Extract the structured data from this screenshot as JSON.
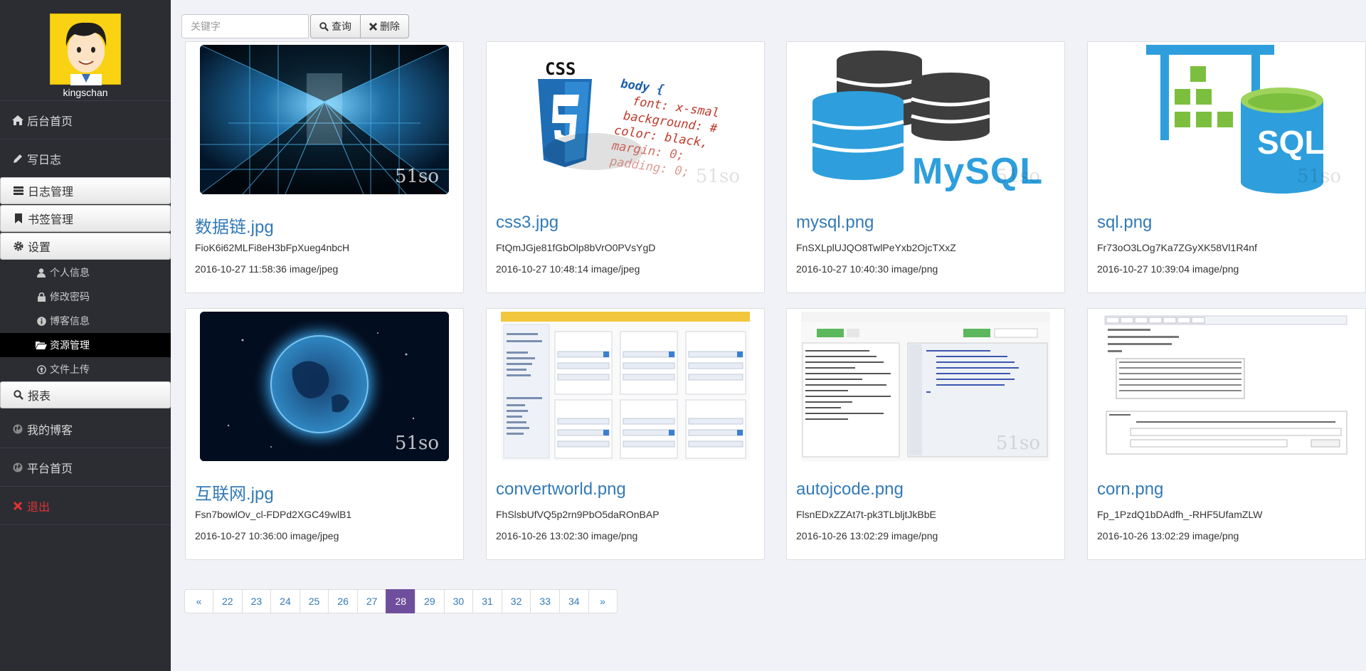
{
  "sidebar": {
    "username": "kingschan",
    "items": [
      {
        "label": "后台首页",
        "icon": "home-icon"
      },
      {
        "label": "写日志",
        "icon": "pencil-icon"
      },
      {
        "label": "日志管理",
        "icon": "list-icon"
      },
      {
        "label": "书签管理",
        "icon": "bookmark-icon"
      },
      {
        "label": "设置",
        "icon": "gear-icon"
      },
      {
        "label": "报表",
        "icon": "search-icon"
      },
      {
        "label": "我的博客",
        "icon": "globe-icon"
      },
      {
        "label": "平台首页",
        "icon": "globe-icon"
      },
      {
        "label": "退出",
        "icon": "close-icon"
      }
    ],
    "sub_items": [
      {
        "label": "个人信息",
        "icon": "user-icon"
      },
      {
        "label": "修改密码",
        "icon": "lock-icon"
      },
      {
        "label": "博客信息",
        "icon": "info-icon"
      },
      {
        "label": "资源管理",
        "icon": "folder-open-icon"
      },
      {
        "label": "文件上传",
        "icon": "upload-icon"
      }
    ]
  },
  "toolbar": {
    "search_placeholder": "关键字",
    "query_label": "查询",
    "delete_label": "删除"
  },
  "cards": [
    {
      "title": "数据链.jpg",
      "key": "FioK6i62MLFi8eH3bFpXueg4nbcH",
      "meta": "2016-10-27 11:58:36 image/jpeg"
    },
    {
      "title": "css3.jpg",
      "key": "FtQmJGje81fGbOlp8bVrO0PVsYgD",
      "meta": "2016-10-27 10:48:14 image/jpeg"
    },
    {
      "title": "mysql.png",
      "key": "FnSXLplUJQO8TwlPeYxb2OjcTXxZ",
      "meta": "2016-10-27 10:40:30 image/png"
    },
    {
      "title": "sql.png",
      "key": "Fr73oO3LOg7Ka7ZGyXK58Vl1R4nf",
      "meta": "2016-10-27 10:39:04 image/png"
    },
    {
      "title": "互联网.jpg",
      "key": "Fsn7bowlOv_cl-FDPd2XGC49wlB1",
      "meta": "2016-10-27 10:36:00 image/jpeg"
    },
    {
      "title": "convertworld.png",
      "key": "FhSlsbUfVQ5p2rn9PbO5daROnBAP",
      "meta": "2016-10-26 13:02:30 image/png"
    },
    {
      "title": "autojcode.png",
      "key": "FlsnEDxZZAt7t-pk3TLbljtJkBbE",
      "meta": "2016-10-26 13:02:29 image/png"
    },
    {
      "title": "corn.png",
      "key": "Fp_1PzdQ1bDAdfh_-RHF5UfamZLW",
      "meta": "2016-10-26 13:02:29 image/png"
    }
  ],
  "thumb_text": {
    "watermark": "51so",
    "css_badge": "CSS",
    "css_num": "3",
    "css_code": [
      "body {",
      "font: x-smal",
      "background: #",
      "color: black,",
      "margin: 0;",
      "padding: 0;"
    ],
    "mysql_label": "MySQL",
    "sql_label": "SQL"
  },
  "pagination": {
    "prev": "«",
    "pages": [
      "22",
      "23",
      "24",
      "25",
      "26",
      "27",
      "28",
      "29",
      "30",
      "31",
      "32",
      "33",
      "34"
    ],
    "active": "28",
    "next": "»"
  }
}
